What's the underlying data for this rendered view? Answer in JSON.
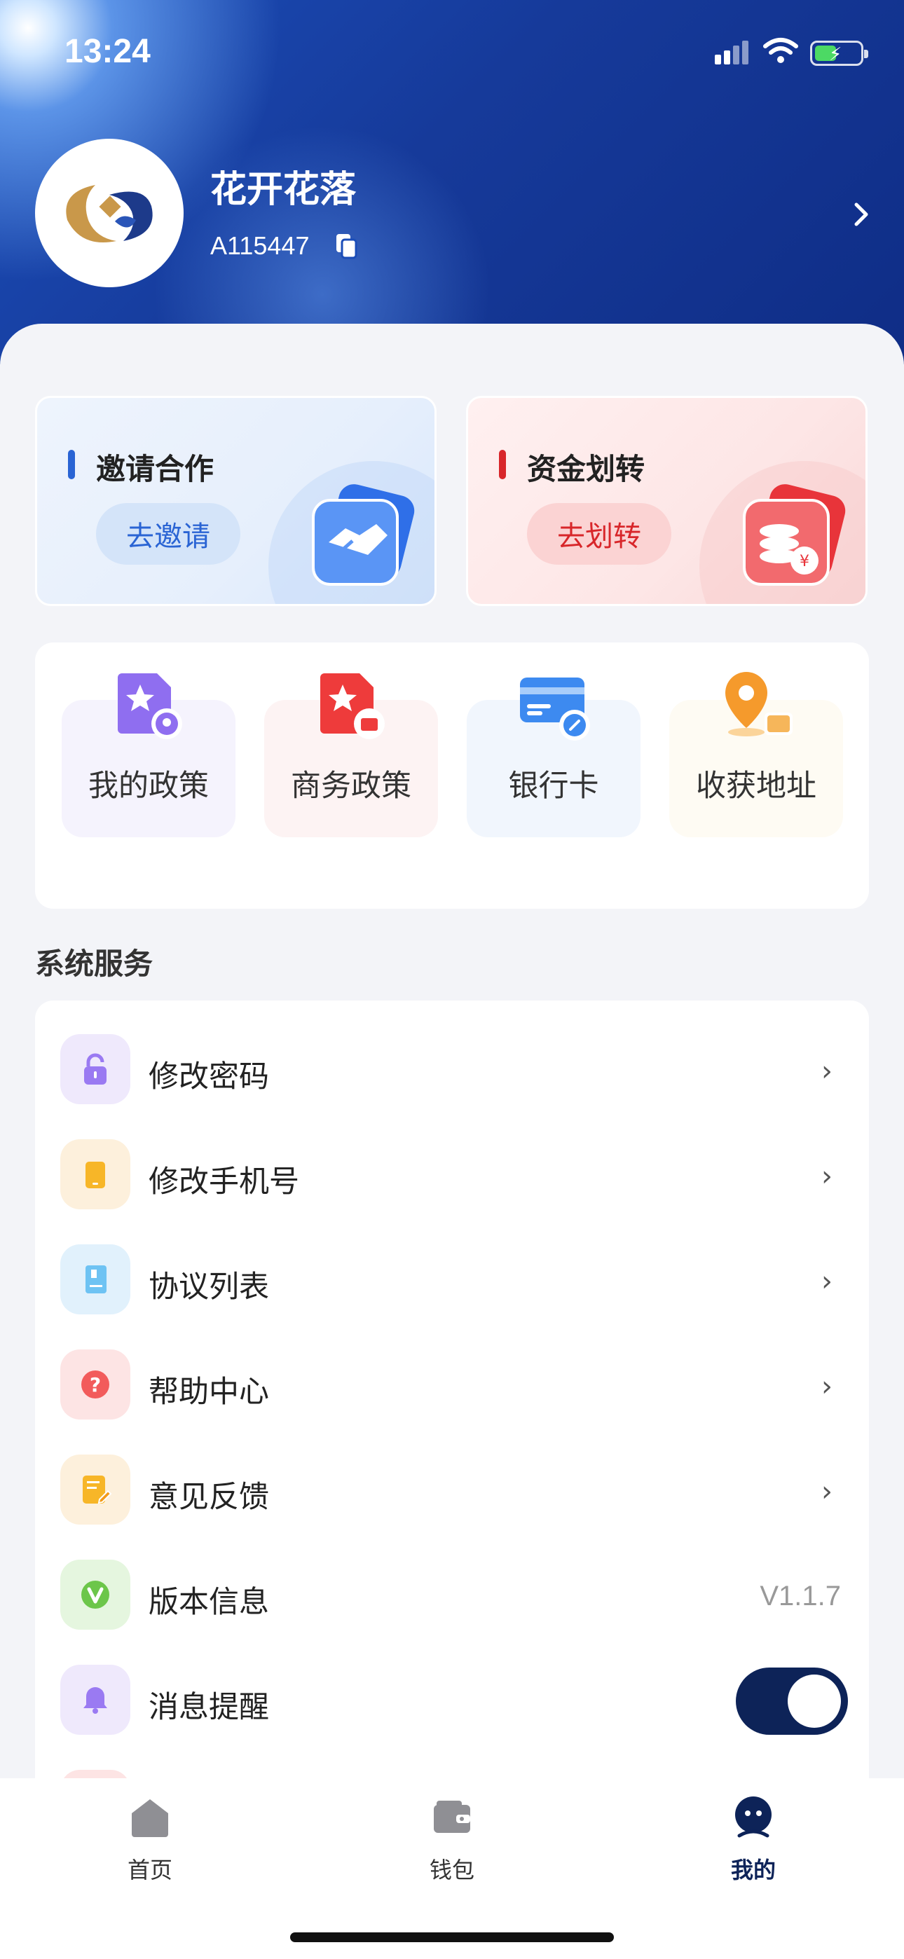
{
  "status_bar": {
    "time": "13:24"
  },
  "profile": {
    "name": "花开花落",
    "id": "A115447"
  },
  "promos": [
    {
      "title": "邀请合作",
      "button": "去邀请",
      "accent": "#2a64d4"
    },
    {
      "title": "资金划转",
      "button": "去划转",
      "accent": "#d8262a"
    }
  ],
  "quick_actions": [
    {
      "label": "我的政策",
      "icon": "policy-star-icon"
    },
    {
      "label": "商务政策",
      "icon": "business-policy-icon"
    },
    {
      "label": "银行卡",
      "icon": "bank-card-icon"
    },
    {
      "label": "收获地址",
      "icon": "location-pin-icon"
    }
  ],
  "system_services": {
    "title": "系统服务",
    "items": [
      {
        "label": "修改密码",
        "icon": "lock-icon"
      },
      {
        "label": "修改手机号",
        "icon": "phone-icon"
      },
      {
        "label": "协议列表",
        "icon": "document-icon"
      },
      {
        "label": "帮助中心",
        "icon": "question-icon"
      },
      {
        "label": "意见反馈",
        "icon": "feedback-icon"
      },
      {
        "label": "版本信息",
        "icon": "version-icon",
        "value": "V1.1.7"
      },
      {
        "label": "消息提醒",
        "icon": "bell-icon",
        "toggle": true
      }
    ]
  },
  "tabs": [
    {
      "label": "首页",
      "icon": "home-icon"
    },
    {
      "label": "钱包",
      "icon": "wallet-icon"
    },
    {
      "label": "我的",
      "icon": "profile-icon",
      "active": true
    }
  ]
}
